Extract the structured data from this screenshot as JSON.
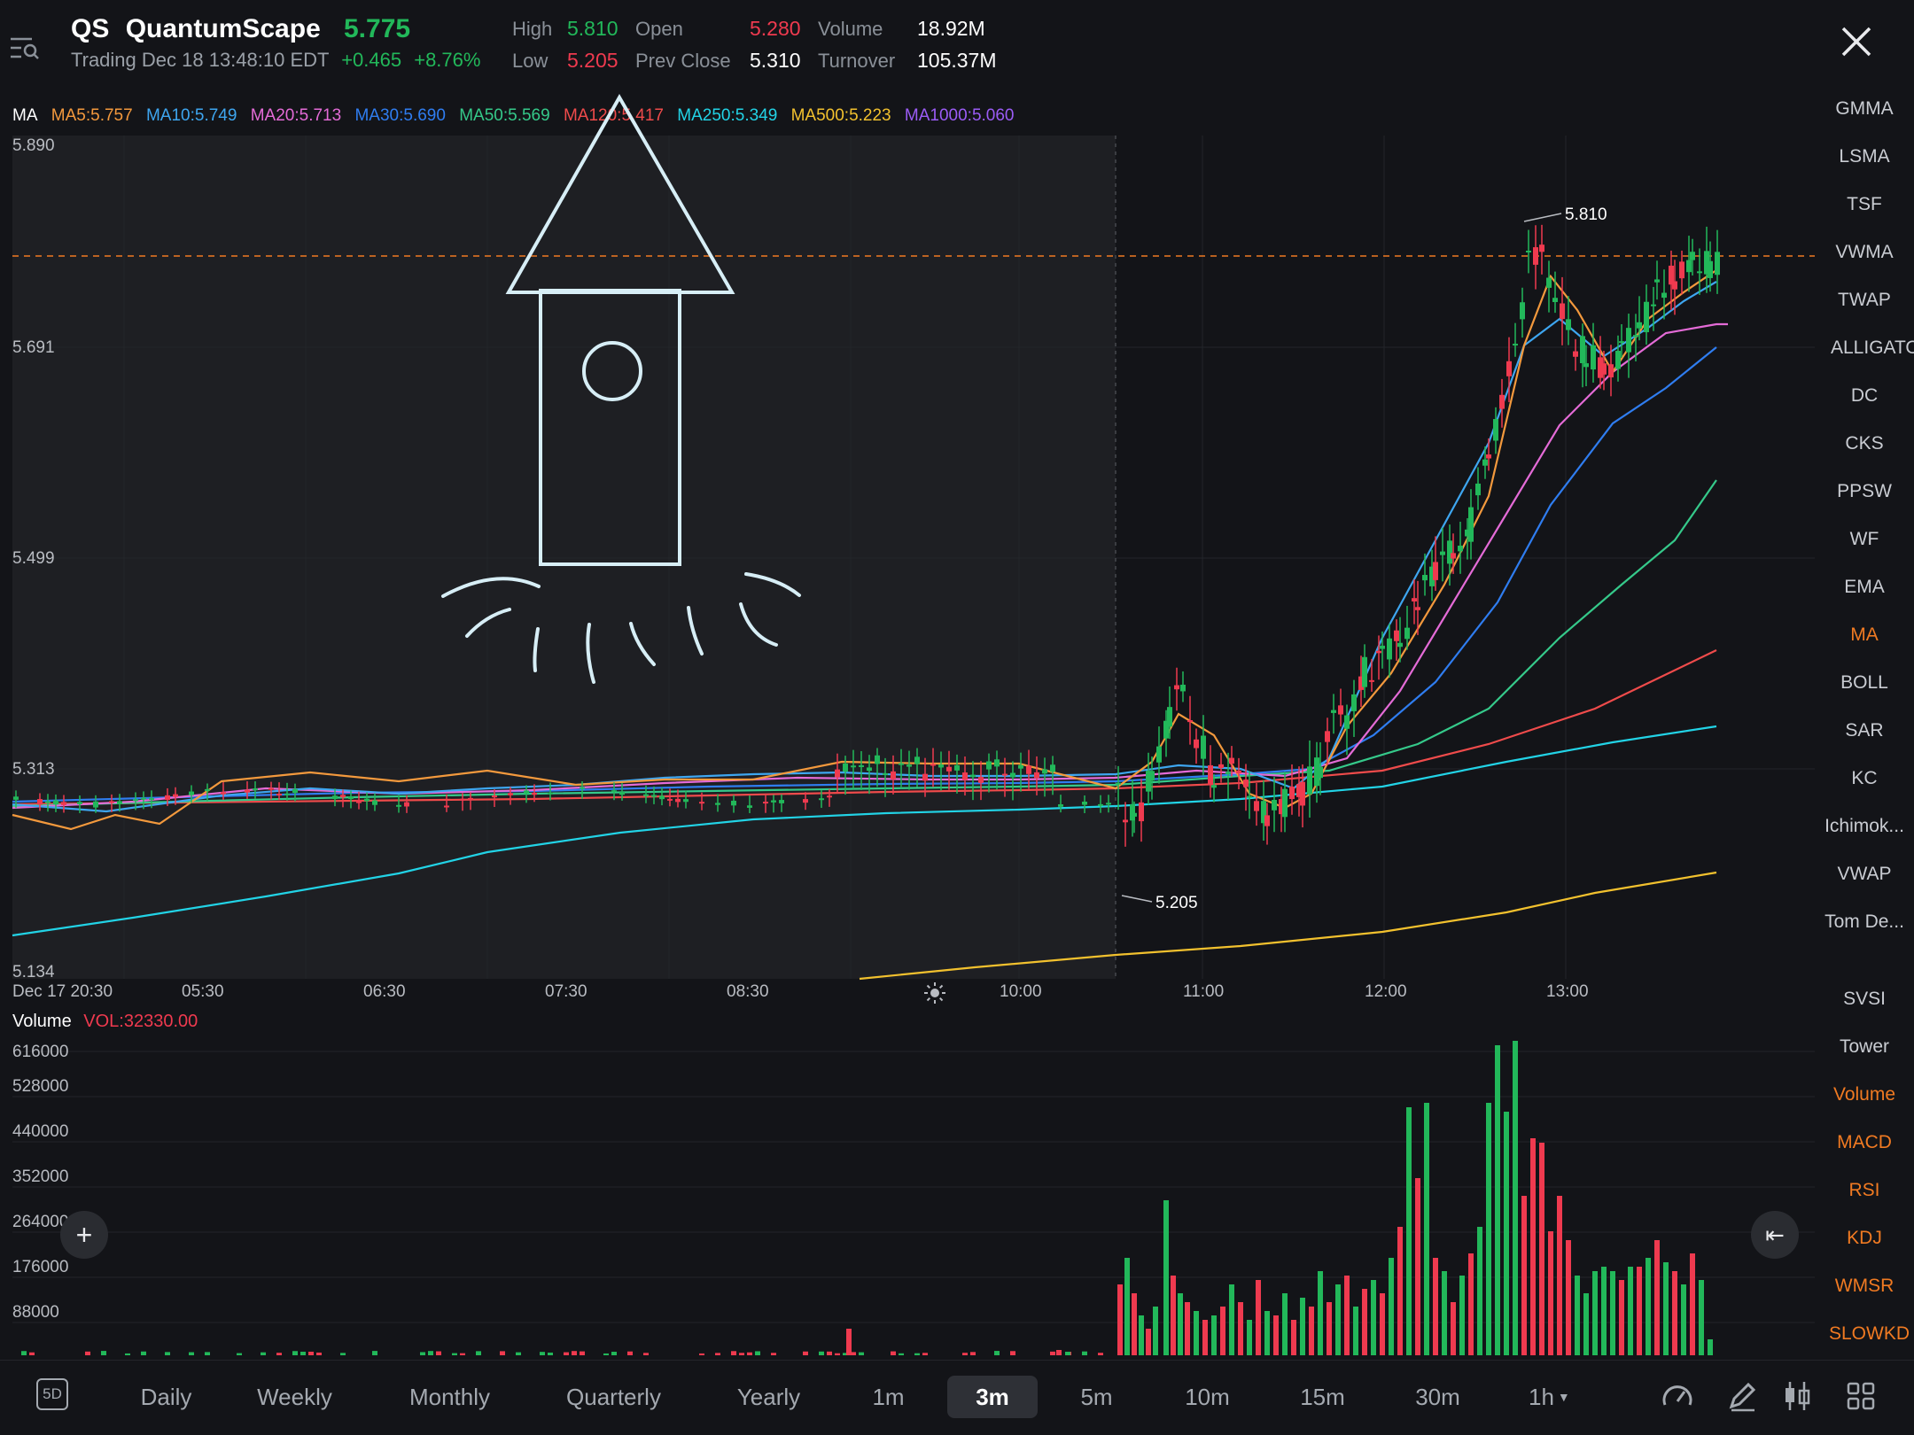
{
  "header": {
    "menu_icon": "list-search-icon",
    "ticker": "QS",
    "name": "QuantumScape",
    "price": "5.775",
    "status": "Trading Dec 18 13:48:10 EDT",
    "change": "+0.465",
    "change_pct": "+8.76%",
    "high_label": "High",
    "high_value": "5.810",
    "low_label": "Low",
    "low_value": "5.205",
    "open_label": "Open",
    "open_value": "5.280",
    "prev_close_label": "Prev Close",
    "prev_close_value": "5.310",
    "volume_label": "Volume",
    "volume_value": "18.92M",
    "turnover_label": "Turnover",
    "turnover_value": "105.37M",
    "close_icon": "close-icon"
  },
  "ma_legend": {
    "title": "MA",
    "items": [
      {
        "label": "MA5:5.757",
        "color": "#f3993d"
      },
      {
        "label": "MA10:5.749",
        "color": "#3ea6f0"
      },
      {
        "label": "MA20:5.713",
        "color": "#e46bd7"
      },
      {
        "label": "MA30:5.690",
        "color": "#2f7df0"
      },
      {
        "label": "MA50:5.569",
        "color": "#35c98a"
      },
      {
        "label": "MA120:5.417",
        "color": "#ef4b4b"
      },
      {
        "label": "MA250:5.349",
        "color": "#22d3e6"
      },
      {
        "label": "MA500:5.223",
        "color": "#f2c12e"
      },
      {
        "label": "MA1000:5.060",
        "color": "#9b5cf6"
      }
    ]
  },
  "chart": {
    "y_ticks": [
      "5.890",
      "5.691",
      "5.499",
      "5.313",
      "5.134"
    ],
    "x_ticks": [
      "Dec 17 20:30",
      "05:30",
      "06:30",
      "07:30",
      "08:30",
      "10:00",
      "11:00",
      "12:00",
      "13:00"
    ],
    "high_marker": "5.810",
    "low_marker": "5.205",
    "session_icon": "sun-icon"
  },
  "chart_data": [
    {
      "type": "line",
      "title": "",
      "description_series": "price (candlestick) with moving averages, 3m interval",
      "x": [
        "Dec 17 20:30",
        "05:30",
        "06:30",
        "07:30",
        "08:30",
        "10:00",
        "11:00",
        "12:00",
        "13:00"
      ],
      "ylim": [
        5.134,
        5.89
      ],
      "series": [
        {
          "name": "MA5:5.757",
          "values": [
            5.29,
            5.3,
            5.31,
            5.3,
            5.32,
            5.3,
            5.3,
            5.43,
            5.78
          ]
        },
        {
          "name": "MA10:5.749",
          "values": [
            5.29,
            5.3,
            5.31,
            5.3,
            5.31,
            5.3,
            5.31,
            5.42,
            5.7
          ]
        },
        {
          "name": "MA20:5.713",
          "values": [
            5.29,
            5.29,
            5.3,
            5.3,
            5.31,
            5.31,
            5.31,
            5.38,
            5.64
          ]
        },
        {
          "name": "MA30:5.690",
          "values": [
            5.28,
            5.29,
            5.3,
            5.3,
            5.3,
            5.3,
            5.3,
            5.36,
            5.6
          ]
        },
        {
          "name": "MA50:5.569",
          "values": [
            5.28,
            5.29,
            5.29,
            5.3,
            5.3,
            5.3,
            5.3,
            5.33,
            5.46
          ]
        },
        {
          "name": "MA120:5.417",
          "values": [
            5.28,
            5.28,
            5.29,
            5.29,
            5.3,
            5.3,
            5.31,
            5.33,
            5.4
          ]
        },
        {
          "name": "MA250:5.349",
          "values": [
            5.14,
            5.17,
            5.2,
            5.24,
            5.26,
            5.28,
            5.29,
            5.3,
            5.33
          ]
        },
        {
          "name": "MA500:5.223",
          "values": [
            null,
            null,
            null,
            null,
            null,
            5.13,
            5.14,
            5.16,
            5.19
          ]
        }
      ],
      "annotations": [
        "5.810",
        "5.205"
      ]
    },
    {
      "type": "bar",
      "title": "Volume",
      "legend": "VOL:32330.00",
      "y_ticks": [
        616000,
        528000,
        440000,
        352000,
        264000,
        176000,
        88000
      ],
      "ylim": [
        0,
        616000
      ],
      "categories": [
        "10:00",
        "11:00",
        "12:00",
        "13:00"
      ],
      "values": [
        5000,
        150000,
        200000,
        600000
      ]
    }
  ],
  "volume_panel": {
    "title": "Volume",
    "vol_value": "VOL:32330.00",
    "y_ticks": [
      "616000",
      "528000",
      "440000",
      "352000",
      "264000",
      "176000",
      "88000"
    ]
  },
  "right_indicators": {
    "top": [
      {
        "label": "GMMA",
        "active": false
      },
      {
        "label": "LSMA",
        "active": false
      },
      {
        "label": "TSF",
        "active": false
      },
      {
        "label": "VWMA",
        "active": false
      },
      {
        "label": "TWAP",
        "active": false
      },
      {
        "label": "ALLIGATOR",
        "active": false
      },
      {
        "label": "DC",
        "active": false
      },
      {
        "label": "CKS",
        "active": false
      },
      {
        "label": "PPSW",
        "active": false
      },
      {
        "label": "WF",
        "active": false
      },
      {
        "label": "EMA",
        "active": false
      },
      {
        "label": "MA",
        "active": true
      },
      {
        "label": "BOLL",
        "active": false
      },
      {
        "label": "SAR",
        "active": false
      },
      {
        "label": "KC",
        "active": false
      },
      {
        "label": "Ichimok...",
        "active": false
      },
      {
        "label": "VWAP",
        "active": false
      },
      {
        "label": "Tom De...",
        "active": false
      }
    ],
    "bottom": [
      {
        "label": "SVSI",
        "active": false
      },
      {
        "label": "Tower",
        "active": false
      },
      {
        "label": "Volume",
        "active": true
      },
      {
        "label": "MACD",
        "active": true
      },
      {
        "label": "RSI",
        "active": true
      },
      {
        "label": "KDJ",
        "active": true
      },
      {
        "label": "WMSR",
        "active": true
      },
      {
        "label": "SLOWKD",
        "active": true
      }
    ]
  },
  "buttons": {
    "add": "+",
    "collapse": "⇤"
  },
  "tabs": {
    "fivd": "5D",
    "items": [
      "Daily",
      "Weekly",
      "Monthly",
      "Quarterly",
      "Yearly",
      "1m",
      "3m",
      "5m",
      "10m",
      "15m",
      "30m",
      "1h"
    ],
    "active": "3m"
  },
  "toolbar_icons": [
    "speedometer-icon",
    "pen-icon",
    "candlestick-icon",
    "grid-icon"
  ],
  "colors": {
    "up": "#22b85a",
    "down": "#ef3a4f",
    "accent": "#f07a22",
    "background": "#131418"
  }
}
